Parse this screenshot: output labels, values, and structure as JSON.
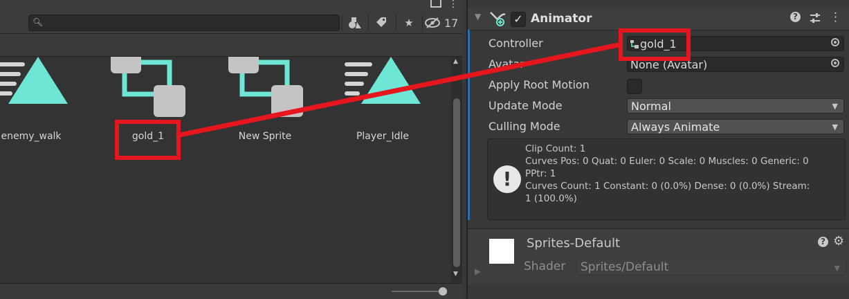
{
  "project": {
    "search_placeholder": "",
    "hidden_count": "17",
    "assets": [
      {
        "name": "enemy_walk",
        "type": "animation-clip"
      },
      {
        "name": "gold_1",
        "type": "animator-controller"
      },
      {
        "name": "New Sprite",
        "type": "animator-controller"
      },
      {
        "name": "Player_Idle",
        "type": "animation-clip"
      }
    ]
  },
  "inspector": {
    "component_title": "Animator",
    "enabled": true,
    "fields": {
      "controller_label": "Controller",
      "controller_value": "gold_1",
      "avatar_label": "Avatar",
      "avatar_value": "None (Avatar)",
      "apply_root_label": "Apply Root Motion",
      "update_mode_label": "Update Mode",
      "update_mode_value": "Normal",
      "culling_mode_label": "Culling Mode",
      "culling_mode_value": "Always Animate"
    },
    "info": {
      "line1": "Clip Count: 1",
      "line2": "Curves Pos: 0 Quat: 0 Euler: 0 Scale: 0 Muscles: 0 Generic: 0",
      "line3": "PPtr: 1",
      "line4": "Curves Count: 1 Constant: 0 (0.0%) Dense: 0 (0.0%) Stream:",
      "line5": "1 (100.0%)"
    },
    "material": {
      "name": "Sprites-Default",
      "shader_label": "Shader",
      "shader_value": "Sprites/Default"
    }
  },
  "colors": {
    "accent_teal": "#6ee6d6",
    "annotation_red": "#e5161e",
    "selection_blue": "#2b6fb3"
  }
}
